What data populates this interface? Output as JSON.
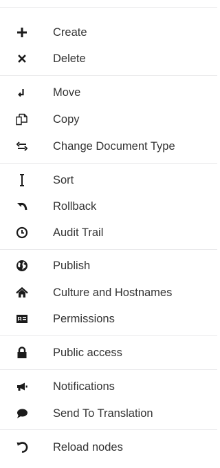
{
  "menu": {
    "items": [
      {
        "id": "create",
        "label": "Create",
        "icon": "plus-icon"
      },
      {
        "id": "delete",
        "label": "Delete",
        "icon": "close-icon"
      },
      {
        "id": "move",
        "label": "Move",
        "icon": "move-icon"
      },
      {
        "id": "copy",
        "label": "Copy",
        "icon": "copy-icon"
      },
      {
        "id": "change-document-type",
        "label": "Change Document Type",
        "icon": "swap-icon"
      },
      {
        "id": "sort",
        "label": "Sort",
        "icon": "sort-icon"
      },
      {
        "id": "rollback",
        "label": "Rollback",
        "icon": "undo-arrow-icon"
      },
      {
        "id": "audit-trail",
        "label": "Audit Trail",
        "icon": "clock-icon"
      },
      {
        "id": "publish",
        "label": "Publish",
        "icon": "globe-icon"
      },
      {
        "id": "culture-and-hostnames",
        "label": "Culture and Hostnames",
        "icon": "home-icon"
      },
      {
        "id": "permissions",
        "label": "Permissions",
        "icon": "id-card-icon"
      },
      {
        "id": "public-access",
        "label": "Public access",
        "icon": "lock-icon"
      },
      {
        "id": "notifications",
        "label": "Notifications",
        "icon": "megaphone-icon"
      },
      {
        "id": "send-to-translation",
        "label": "Send To Translation",
        "icon": "chat-bubble-icon"
      },
      {
        "id": "reload-nodes",
        "label": "Reload nodes",
        "icon": "reload-icon"
      }
    ]
  },
  "colors": {
    "text": "#343434",
    "icon": "#1b1b1b",
    "divider": "#e9e9eb",
    "background": "#ffffff"
  }
}
